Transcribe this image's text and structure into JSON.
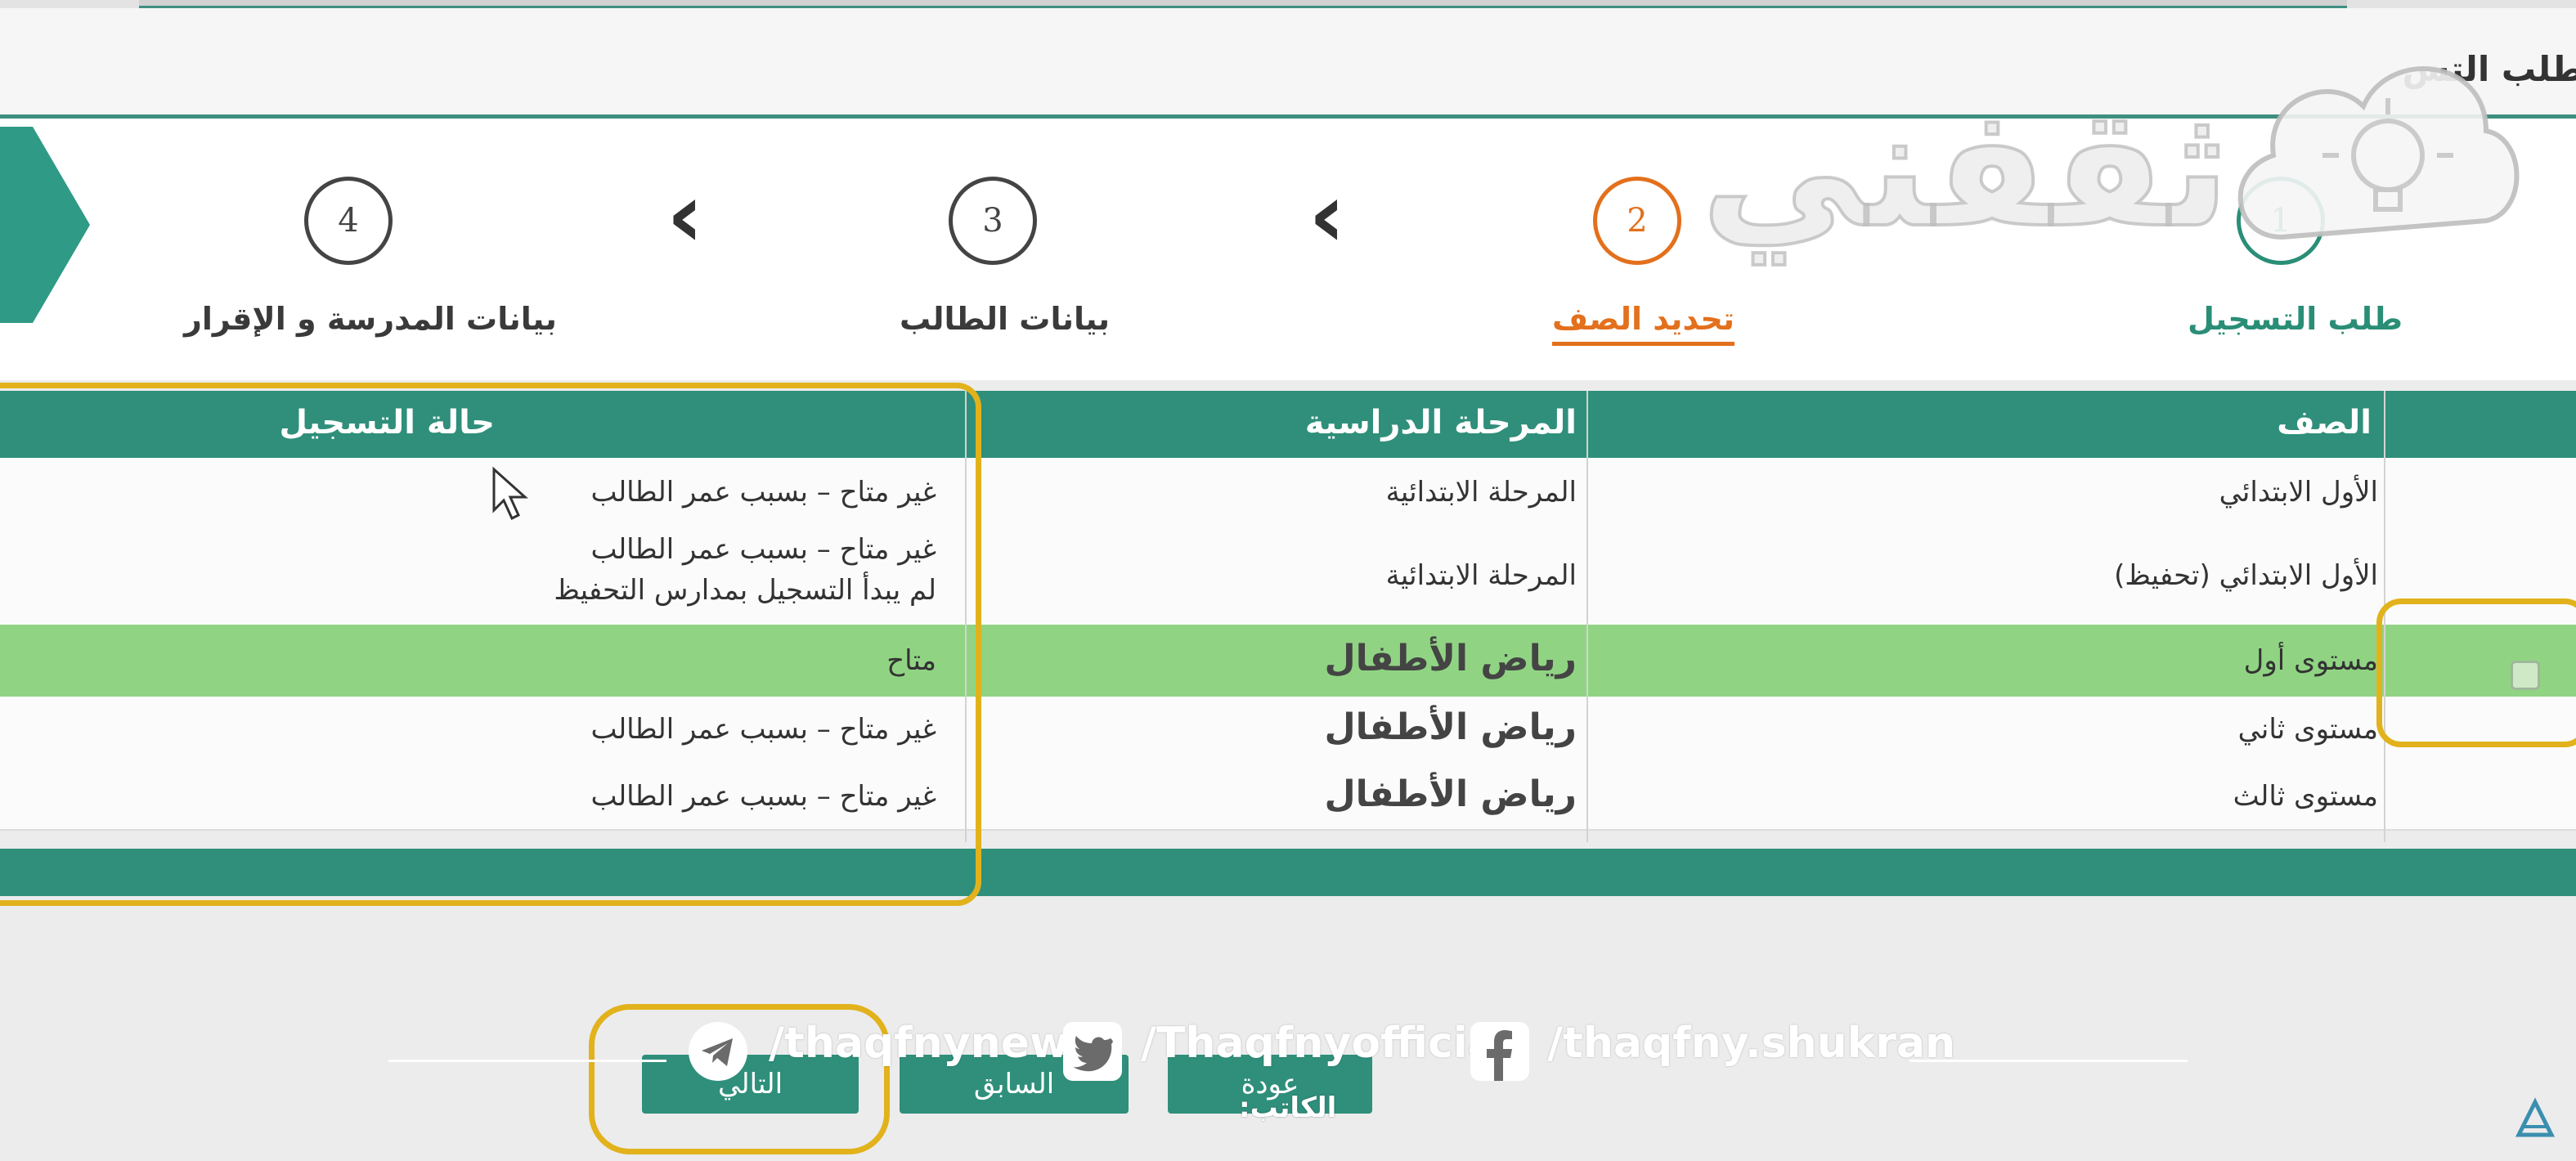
{
  "header": {
    "title": "طلب التس"
  },
  "watermark": {
    "text": "ثقفني"
  },
  "steps": [
    {
      "number": "1",
      "label": "طلب التسجيل",
      "state": "done"
    },
    {
      "number": "2",
      "label": "تحديد الصف",
      "state": "active"
    },
    {
      "number": "3",
      "label": "بيانات الطالب",
      "state": "pending"
    },
    {
      "number": "4",
      "label": "بيانات المدرسة و الإقرار",
      "state": "pending"
    }
  ],
  "table": {
    "headers": {
      "grade": "الصف",
      "stage": "المرحلة الدراسية",
      "status": "حالة التسجيل"
    },
    "rows": [
      {
        "grade": "الأول الابتدائي",
        "stage": "المرحلة الابتدائية",
        "status": "غير متاح – بسبب عمر الطالب",
        "status2": ""
      },
      {
        "grade": "الأول الابتدائي (تحفيظ)",
        "stage": "المرحلة الابتدائية",
        "status": "غير متاح – بسبب عمر الطالب",
        "status2": "لم يبدأ التسجيل بمدارس التحفيظ"
      },
      {
        "grade": "مستوى أول",
        "stage": "رياض الأطفال",
        "status": "متاح",
        "status2": ""
      },
      {
        "grade": "مستوى ثاني",
        "stage": "رياض الأطفال",
        "status": "غير متاح – بسبب عمر الطالب",
        "status2": ""
      },
      {
        "grade": "مستوى ثالث",
        "stage": "رياض الأطفال",
        "status": "غير متاح – بسبب عمر الطالب",
        "status2": ""
      }
    ]
  },
  "buttons": {
    "next": "التالي",
    "previous": "السابق",
    "back": "عودة"
  },
  "social": {
    "telegram": "/thaqfnynews",
    "twitter": "/Thaqfnyofficial",
    "facebook": "/thaqfny.shukran"
  },
  "author_label": "الكاتب:",
  "colors": {
    "primary": "#2f8f7b",
    "accent": "#e3701c",
    "highlight": "#e2b21c",
    "selected_row": "#90d483"
  }
}
